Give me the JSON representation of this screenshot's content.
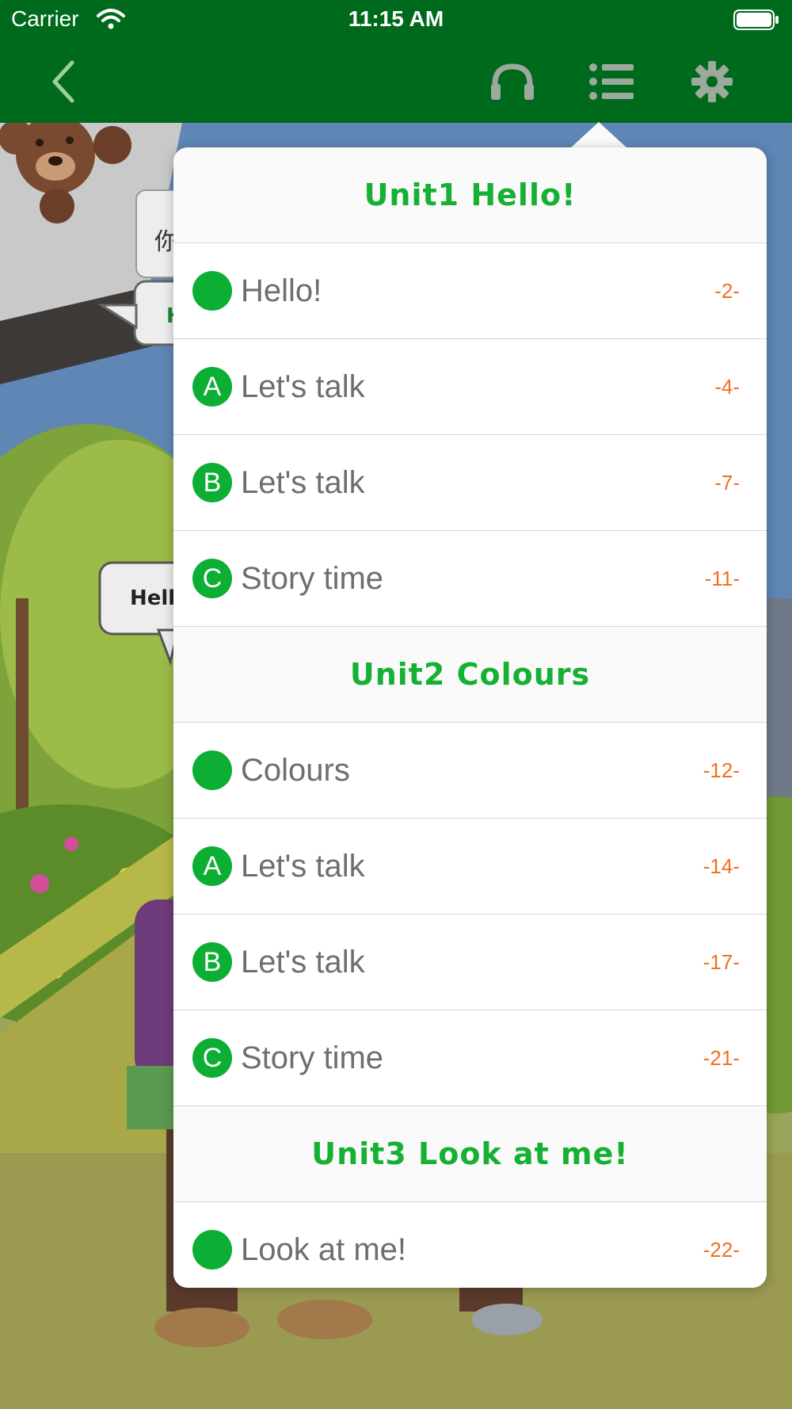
{
  "status_bar": {
    "carrier": "Carrier",
    "time": "11:15 AM"
  },
  "nav": {
    "back_icon": "chevron-left-icon",
    "audio_icon": "headphones-icon",
    "menu_icon": "list-icon",
    "settings_icon": "gear-icon"
  },
  "colors": {
    "nav_green": "#006a1c",
    "unit_green": "#16b033",
    "badge_green": "#0cae34",
    "page_orange": "#f07020"
  },
  "scene": {
    "bubble_1": "你",
    "bubble_2": "H",
    "bubble_3": "Hello"
  },
  "toc": [
    {
      "unit": "Unit1  Hello!",
      "items": [
        {
          "badge": "",
          "label": "Hello!",
          "page": "-2-"
        },
        {
          "badge": "A",
          "label": "Let's talk",
          "page": "-4-"
        },
        {
          "badge": "B",
          "label": "Let's talk",
          "page": "-7-"
        },
        {
          "badge": "C",
          "label": "Story time",
          "page": "-11-"
        }
      ]
    },
    {
      "unit": "Unit2  Colours",
      "items": [
        {
          "badge": "",
          "label": "Colours",
          "page": "-12-"
        },
        {
          "badge": "A",
          "label": "Let's talk",
          "page": "-14-"
        },
        {
          "badge": "B",
          "label": "Let's talk",
          "page": "-17-"
        },
        {
          "badge": "C",
          "label": "Story time",
          "page": "-21-"
        }
      ]
    },
    {
      "unit": "Unit3  Look at me!",
      "items": [
        {
          "badge": "",
          "label": "Look at me!",
          "page": "-22-"
        }
      ]
    }
  ]
}
